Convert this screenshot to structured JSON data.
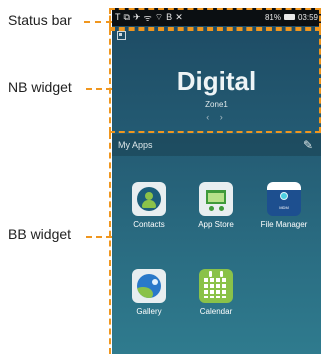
{
  "annotations": {
    "status_bar": "Status bar",
    "nb_widget": "NB widget",
    "bb_widget": "BB widget",
    "accent_color": "#f0961e"
  },
  "status_bar": {
    "left_icons": [
      "T",
      "⧉",
      "✈",
      "ᯤ",
      "⌔",
      "B",
      "✕"
    ],
    "battery_text": "81%",
    "time": "03:59"
  },
  "nb_widget": {
    "title": "Digital",
    "zone": "Zone1",
    "pager": "‹ ›"
  },
  "bb_widget": {
    "header": "My Apps",
    "apps": [
      {
        "label": "Contacts",
        "icon": "contacts-icon"
      },
      {
        "label": "App Store",
        "icon": "app-store-icon"
      },
      {
        "label": "File Manager",
        "icon": "file-manager-icon",
        "badge": "MDM"
      },
      {
        "label": "Gallery",
        "icon": "gallery-icon"
      },
      {
        "label": "Calendar",
        "icon": "calendar-icon"
      }
    ]
  }
}
